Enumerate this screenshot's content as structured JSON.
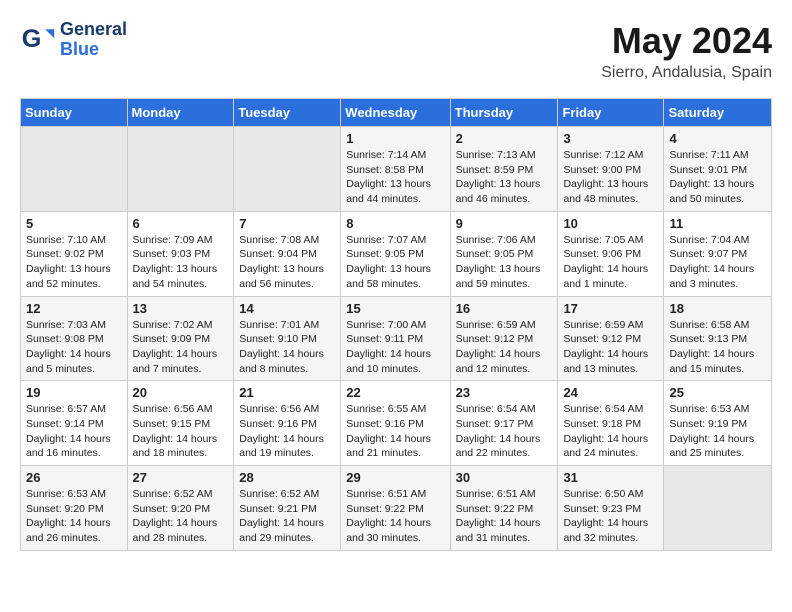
{
  "header": {
    "logo_general": "General",
    "logo_blue": "Blue",
    "month": "May 2024",
    "location": "Sierro, Andalusia, Spain"
  },
  "weekdays": [
    "Sunday",
    "Monday",
    "Tuesday",
    "Wednesday",
    "Thursday",
    "Friday",
    "Saturday"
  ],
  "weeks": [
    [
      {
        "day": "",
        "content": ""
      },
      {
        "day": "",
        "content": ""
      },
      {
        "day": "",
        "content": ""
      },
      {
        "day": "1",
        "content": "Sunrise: 7:14 AM\nSunset: 8:58 PM\nDaylight: 13 hours and 44 minutes."
      },
      {
        "day": "2",
        "content": "Sunrise: 7:13 AM\nSunset: 8:59 PM\nDaylight: 13 hours and 46 minutes."
      },
      {
        "day": "3",
        "content": "Sunrise: 7:12 AM\nSunset: 9:00 PM\nDaylight: 13 hours and 48 minutes."
      },
      {
        "day": "4",
        "content": "Sunrise: 7:11 AM\nSunset: 9:01 PM\nDaylight: 13 hours and 50 minutes."
      }
    ],
    [
      {
        "day": "5",
        "content": "Sunrise: 7:10 AM\nSunset: 9:02 PM\nDaylight: 13 hours and 52 minutes."
      },
      {
        "day": "6",
        "content": "Sunrise: 7:09 AM\nSunset: 9:03 PM\nDaylight: 13 hours and 54 minutes."
      },
      {
        "day": "7",
        "content": "Sunrise: 7:08 AM\nSunset: 9:04 PM\nDaylight: 13 hours and 56 minutes."
      },
      {
        "day": "8",
        "content": "Sunrise: 7:07 AM\nSunset: 9:05 PM\nDaylight: 13 hours and 58 minutes."
      },
      {
        "day": "9",
        "content": "Sunrise: 7:06 AM\nSunset: 9:05 PM\nDaylight: 13 hours and 59 minutes."
      },
      {
        "day": "10",
        "content": "Sunrise: 7:05 AM\nSunset: 9:06 PM\nDaylight: 14 hours and 1 minute."
      },
      {
        "day": "11",
        "content": "Sunrise: 7:04 AM\nSunset: 9:07 PM\nDaylight: 14 hours and 3 minutes."
      }
    ],
    [
      {
        "day": "12",
        "content": "Sunrise: 7:03 AM\nSunset: 9:08 PM\nDaylight: 14 hours and 5 minutes."
      },
      {
        "day": "13",
        "content": "Sunrise: 7:02 AM\nSunset: 9:09 PM\nDaylight: 14 hours and 7 minutes."
      },
      {
        "day": "14",
        "content": "Sunrise: 7:01 AM\nSunset: 9:10 PM\nDaylight: 14 hours and 8 minutes."
      },
      {
        "day": "15",
        "content": "Sunrise: 7:00 AM\nSunset: 9:11 PM\nDaylight: 14 hours and 10 minutes."
      },
      {
        "day": "16",
        "content": "Sunrise: 6:59 AM\nSunset: 9:12 PM\nDaylight: 14 hours and 12 minutes."
      },
      {
        "day": "17",
        "content": "Sunrise: 6:59 AM\nSunset: 9:12 PM\nDaylight: 14 hours and 13 minutes."
      },
      {
        "day": "18",
        "content": "Sunrise: 6:58 AM\nSunset: 9:13 PM\nDaylight: 14 hours and 15 minutes."
      }
    ],
    [
      {
        "day": "19",
        "content": "Sunrise: 6:57 AM\nSunset: 9:14 PM\nDaylight: 14 hours and 16 minutes."
      },
      {
        "day": "20",
        "content": "Sunrise: 6:56 AM\nSunset: 9:15 PM\nDaylight: 14 hours and 18 minutes."
      },
      {
        "day": "21",
        "content": "Sunrise: 6:56 AM\nSunset: 9:16 PM\nDaylight: 14 hours and 19 minutes."
      },
      {
        "day": "22",
        "content": "Sunrise: 6:55 AM\nSunset: 9:16 PM\nDaylight: 14 hours and 21 minutes."
      },
      {
        "day": "23",
        "content": "Sunrise: 6:54 AM\nSunset: 9:17 PM\nDaylight: 14 hours and 22 minutes."
      },
      {
        "day": "24",
        "content": "Sunrise: 6:54 AM\nSunset: 9:18 PM\nDaylight: 14 hours and 24 minutes."
      },
      {
        "day": "25",
        "content": "Sunrise: 6:53 AM\nSunset: 9:19 PM\nDaylight: 14 hours and 25 minutes."
      }
    ],
    [
      {
        "day": "26",
        "content": "Sunrise: 6:53 AM\nSunset: 9:20 PM\nDaylight: 14 hours and 26 minutes."
      },
      {
        "day": "27",
        "content": "Sunrise: 6:52 AM\nSunset: 9:20 PM\nDaylight: 14 hours and 28 minutes."
      },
      {
        "day": "28",
        "content": "Sunrise: 6:52 AM\nSunset: 9:21 PM\nDaylight: 14 hours and 29 minutes."
      },
      {
        "day": "29",
        "content": "Sunrise: 6:51 AM\nSunset: 9:22 PM\nDaylight: 14 hours and 30 minutes."
      },
      {
        "day": "30",
        "content": "Sunrise: 6:51 AM\nSunset: 9:22 PM\nDaylight: 14 hours and 31 minutes."
      },
      {
        "day": "31",
        "content": "Sunrise: 6:50 AM\nSunset: 9:23 PM\nDaylight: 14 hours and 32 minutes."
      },
      {
        "day": "",
        "content": ""
      }
    ]
  ]
}
